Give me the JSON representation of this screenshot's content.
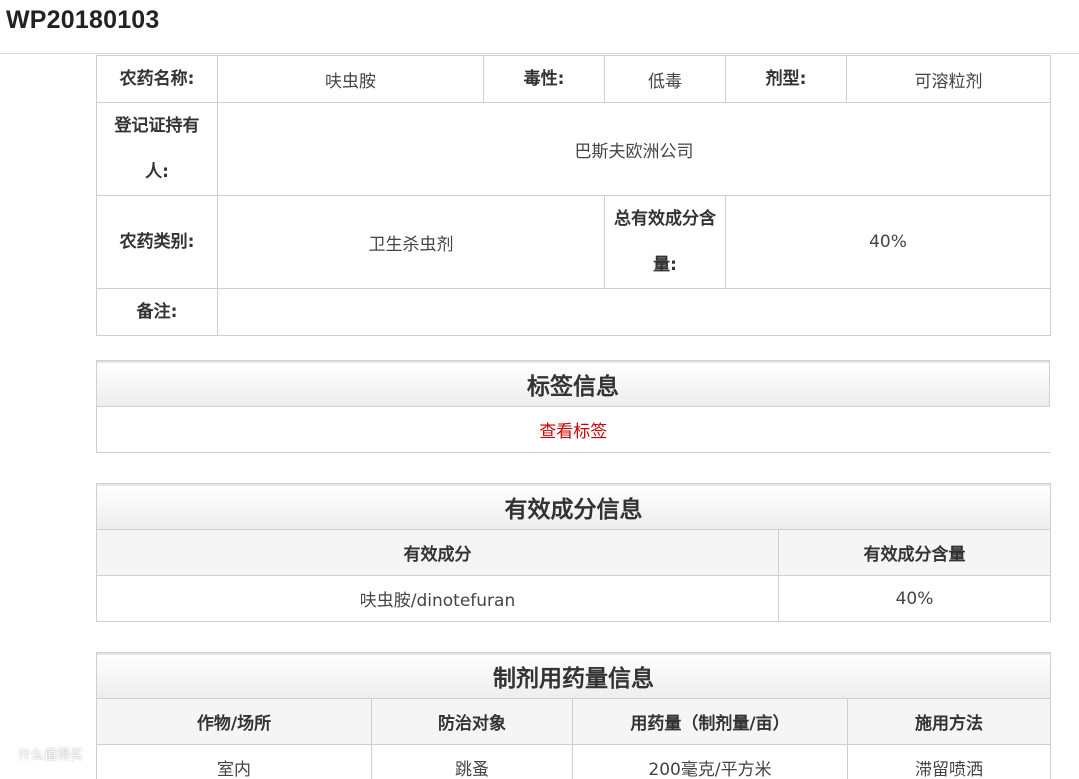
{
  "header": {
    "registration_no": "WP20180103"
  },
  "basic_info": {
    "pesticide_name_label": "农药名称:",
    "pesticide_name": "呋虫胺",
    "toxicity_label": "毒性:",
    "toxicity": "低毒",
    "formulation_label": "剂型:",
    "formulation": "可溶粒剂",
    "holder_label": "登记证持有人:",
    "holder": "巴斯夫欧洲公司",
    "category_label": "农药类别:",
    "category": "卫生杀虫剂",
    "total_content_label": "总有效成分含量:",
    "total_content": "40%",
    "remarks_label": "备注:",
    "remarks": ""
  },
  "label_section": {
    "title": "标签信息",
    "view_label_link": "查看标签"
  },
  "ingredient_section": {
    "title": "有效成分信息",
    "columns": [
      "有效成分",
      "有效成分含量"
    ],
    "rows": [
      [
        "呋虫胺/dinotefuran",
        "40%"
      ]
    ]
  },
  "dosage_section": {
    "title": "制剂用药量信息",
    "columns": [
      "作物/场所",
      "防治对象",
      "用药量（制剂量/亩）",
      "施用方法"
    ],
    "rows": [
      [
        "室内",
        "跳蚤",
        "200毫克/平方米",
        "滞留喷洒"
      ]
    ]
  },
  "watermark": "什么值得买"
}
